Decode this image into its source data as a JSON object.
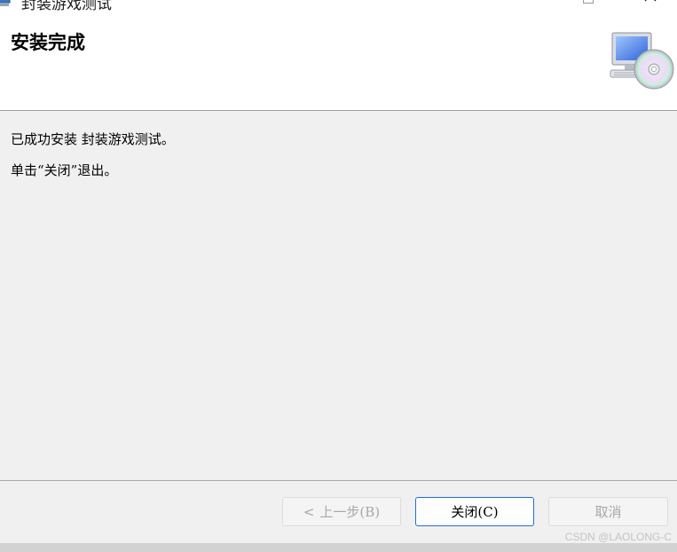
{
  "window": {
    "title": "封装游戏测试"
  },
  "banner": {
    "title": "安装完成",
    "graphic": "computer-cd-setup-icon"
  },
  "body": {
    "line1": "已成功安装 封装游戏测试。",
    "line2": "单击“关闭”退出。"
  },
  "buttons": {
    "back_arrow": "<",
    "back": "上一步(B)",
    "close": "关闭(C)",
    "cancel": "取消"
  },
  "watermark": "CSDN @LAOLONG-C",
  "colors": {
    "accent_border": "#1e6fcf",
    "disabled_text": "#a8a8a8"
  }
}
